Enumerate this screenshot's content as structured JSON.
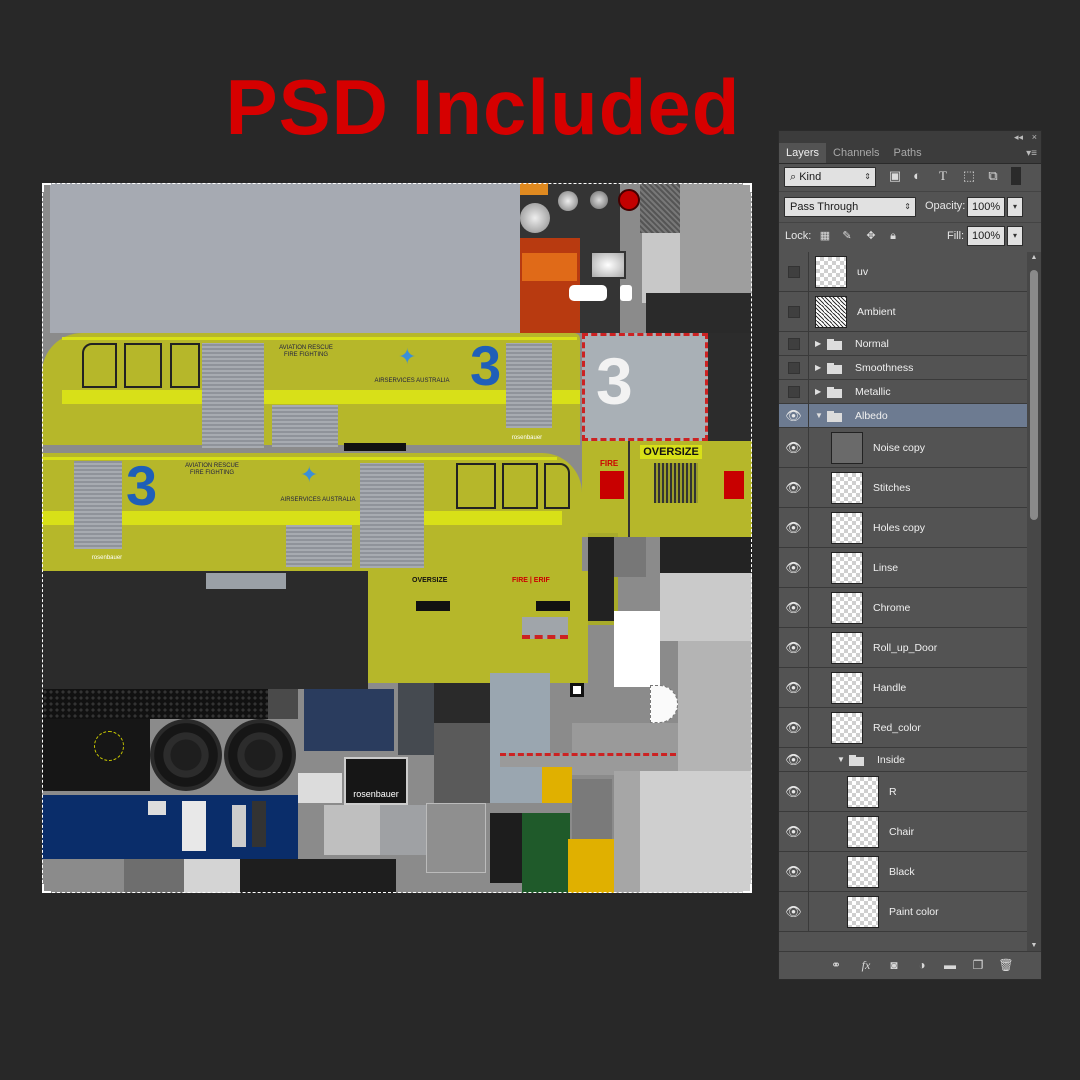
{
  "headline": "PSD Included",
  "texture": {
    "truck_number": "3",
    "label_arff": "AVIATION RESCUE\nFIRE FIGHTING",
    "label_airservices": "AIRSERVICES AUSTRALIA",
    "label_rosenbauer": "rosenbauer",
    "label_oversize": "OVERSIZE",
    "label_fire": "FIRE",
    "label_fire_mirror": "FIRE | ERIF",
    "plate": "rosenbauer"
  },
  "panel": {
    "collapse_glyph": "◂◂",
    "close_glyph": "×",
    "tabs": [
      "Layers",
      "Channels",
      "Paths"
    ],
    "menu_glyph": "▾≡",
    "filter_kind": "Kind",
    "blend_mode": "Pass Through",
    "opacity_label": "Opacity:",
    "opacity_value": "100%",
    "lock_label": "Lock:",
    "fill_label": "Fill:",
    "fill_value": "100%",
    "layers": [
      {
        "name": "uv",
        "visible": false,
        "kind": "thumb"
      },
      {
        "name": "Ambient",
        "visible": false,
        "kind": "thumb-ao"
      },
      {
        "name": "Normal",
        "visible": false,
        "kind": "group-closed"
      },
      {
        "name": "Smoothness",
        "visible": false,
        "kind": "group-closed"
      },
      {
        "name": "Metallic",
        "visible": false,
        "kind": "group-closed"
      },
      {
        "name": "Albedo",
        "visible": true,
        "kind": "group-open",
        "selected": true
      },
      {
        "name": "Noise copy",
        "visible": true,
        "kind": "child-gray"
      },
      {
        "name": "Stitches",
        "visible": true,
        "kind": "child"
      },
      {
        "name": "Holes copy",
        "visible": true,
        "kind": "child"
      },
      {
        "name": "Linse",
        "visible": true,
        "kind": "child"
      },
      {
        "name": "Chrome",
        "visible": true,
        "kind": "child"
      },
      {
        "name": "Roll_up_Door",
        "visible": true,
        "kind": "child"
      },
      {
        "name": "Handle",
        "visible": true,
        "kind": "child"
      },
      {
        "name": "Red_color",
        "visible": true,
        "kind": "child"
      },
      {
        "name": "Inside",
        "visible": true,
        "kind": "subgroup-open"
      },
      {
        "name": "R",
        "visible": true,
        "kind": "grandchild"
      },
      {
        "name": "Chair",
        "visible": true,
        "kind": "grandchild"
      },
      {
        "name": "Black",
        "visible": true,
        "kind": "grandchild"
      },
      {
        "name": "Paint color",
        "visible": true,
        "kind": "grandchild"
      }
    ],
    "footer_icons": [
      "link-icon",
      "fx-icon",
      "mask-icon",
      "adjustment-icon",
      "folder-icon",
      "new-layer-icon",
      "trash-icon"
    ]
  },
  "colors": {
    "headline": "#d60000",
    "yellow": "#b6b72a",
    "selected_row": "#6d7b91",
    "background": "#282828"
  }
}
